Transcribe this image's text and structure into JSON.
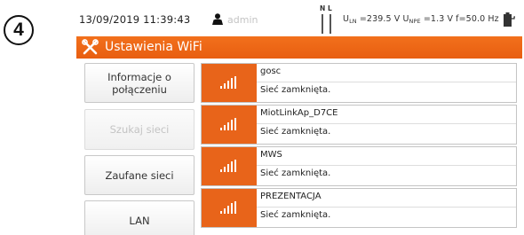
{
  "step_number": "4",
  "status_bar": {
    "datetime": "13/09/2019 11:39:43",
    "user": "admin",
    "n_label": "N",
    "l_label": "L",
    "uln_prefix": "U",
    "uln_sub": "LN",
    "uln_value": " =239.5 V",
    "upe_prefix": " U",
    "upe_sub": "NPE",
    "upe_value": " =1.3 V",
    "freq": " f=50.0 Hz"
  },
  "title_bar": {
    "title": "Ustawienia WiFi"
  },
  "menu": {
    "items": [
      {
        "label": "Informacje o połączeniu",
        "enabled": true
      },
      {
        "label": "Szukaj sieci",
        "enabled": false
      },
      {
        "label": "Zaufane sieci",
        "enabled": true
      },
      {
        "label": "LAN",
        "enabled": true
      }
    ]
  },
  "networks": [
    {
      "ssid": "gosc",
      "status": "Sieć zamknięta.",
      "signal": "wifi-signal-icon"
    },
    {
      "ssid": "MiotLinkAp_D7CE",
      "status": "Sieć zamknięta.",
      "signal": "wifi-signal-icon"
    },
    {
      "ssid": "MWS",
      "status": "Sieć zamknięta.",
      "signal": "wifi-signal-icon"
    },
    {
      "ssid": "PREZENTACJA",
      "status": "Sieć zamknięta.",
      "signal": "wifi-signal-icon"
    }
  ],
  "colors": {
    "accent": "#e8641a",
    "disabled_text": "#c4c4c4"
  }
}
